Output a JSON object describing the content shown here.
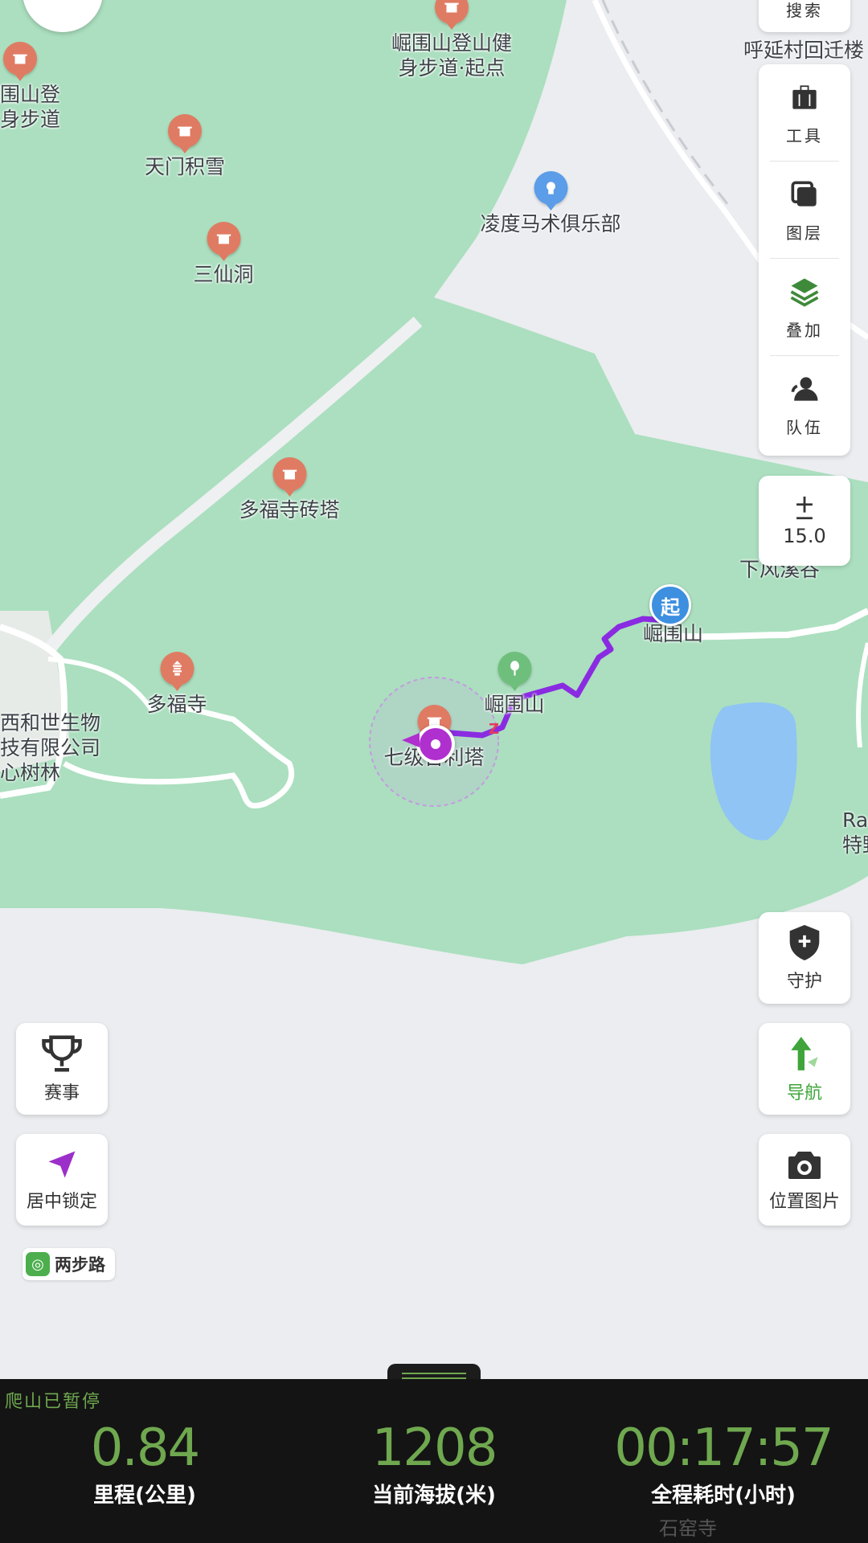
{
  "map": {
    "pois": [
      {
        "id": "poi-start-trail",
        "label": "崛围山登山健\n身步道·起点",
        "kind": "temple"
      },
      {
        "id": "poi-trail-left",
        "label": "崛围山登\n健身步道",
        "kind": "temple"
      },
      {
        "id": "poi-tianmen",
        "label": "天门积雪",
        "kind": "temple"
      },
      {
        "id": "poi-sanxian",
        "label": "三仙洞",
        "kind": "temple"
      },
      {
        "id": "poi-lingdu",
        "label": "凌度马术俱乐部",
        "kind": "club"
      },
      {
        "id": "poi-duofu-tower",
        "label": "多福寺砖塔",
        "kind": "temple"
      },
      {
        "id": "poi-duofu",
        "label": "多福寺",
        "kind": "pagoda"
      },
      {
        "id": "poi-qiji",
        "label": "七级舍利塔",
        "kind": "temple"
      },
      {
        "id": "poi-jueweishan-peak",
        "label": "崛围山",
        "kind": "park"
      }
    ],
    "labels": {
      "hebei_village": "呼延村回迁楼",
      "xiafeng": "下风溪谷",
      "jueweishan_right": "崛围山",
      "company": "西和世生物\n技有限公司\n心树林",
      "ra": "Ra\n特野",
      "shiyao": "石窑寺",
      "start_marker": "起"
    }
  },
  "toolbar": {
    "search_label": "搜索",
    "items": [
      {
        "id": "tools",
        "label": "工具",
        "icon": "toolbox-icon"
      },
      {
        "id": "layers",
        "label": "图层",
        "icon": "layers-icon"
      },
      {
        "id": "overlay",
        "label": "叠加",
        "icon": "stack-icon"
      },
      {
        "id": "team",
        "label": "队伍",
        "icon": "team-icon"
      }
    ]
  },
  "zoom": {
    "level": "15.0"
  },
  "buttons": {
    "guard": "守护",
    "navigate": "导航",
    "photo": "位置图片",
    "events": "赛事",
    "center_lock": "居中锁定",
    "brand": "两步路"
  },
  "stats": {
    "status": "爬山已暂停",
    "distance": {
      "value": "0.84",
      "label": "里程(公里)"
    },
    "altitude": {
      "value": "1208",
      "label": "当前海拔(米)"
    },
    "elapsed": {
      "value": "00:17:57",
      "label": "全程耗时(小时)"
    }
  },
  "colors": {
    "park_green": "#abdfbf",
    "route_purple": "#8a2be2",
    "stats_green": "#6fa84f",
    "pin_orange": "#e07b63"
  }
}
